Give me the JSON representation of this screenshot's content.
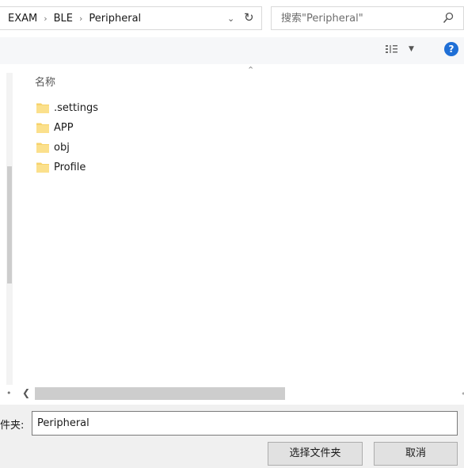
{
  "breadcrumb": {
    "items": [
      "EXAM",
      "BLE",
      "Peripheral"
    ],
    "separator": "›"
  },
  "search": {
    "placeholder": "搜索\"Peripheral\""
  },
  "toolbar": {
    "view_icon": "details-view-icon",
    "help_icon": "help-icon",
    "help_label": "?"
  },
  "file_list": {
    "column_header": "名称",
    "items": [
      {
        "name": ".settings",
        "icon": "folder-icon"
      },
      {
        "name": "APP",
        "icon": "folder-icon"
      },
      {
        "name": "obj",
        "icon": "folder-icon"
      },
      {
        "name": "Profile",
        "icon": "folder-icon"
      }
    ]
  },
  "footer": {
    "folder_label": "件夹:",
    "folder_value": "Peripheral",
    "select_button": "选择文件夹",
    "cancel_button": "取消"
  },
  "colors": {
    "folder": "#f7d36b",
    "accent": "#1f6fd6",
    "footer_bg": "#f0f0f0"
  }
}
